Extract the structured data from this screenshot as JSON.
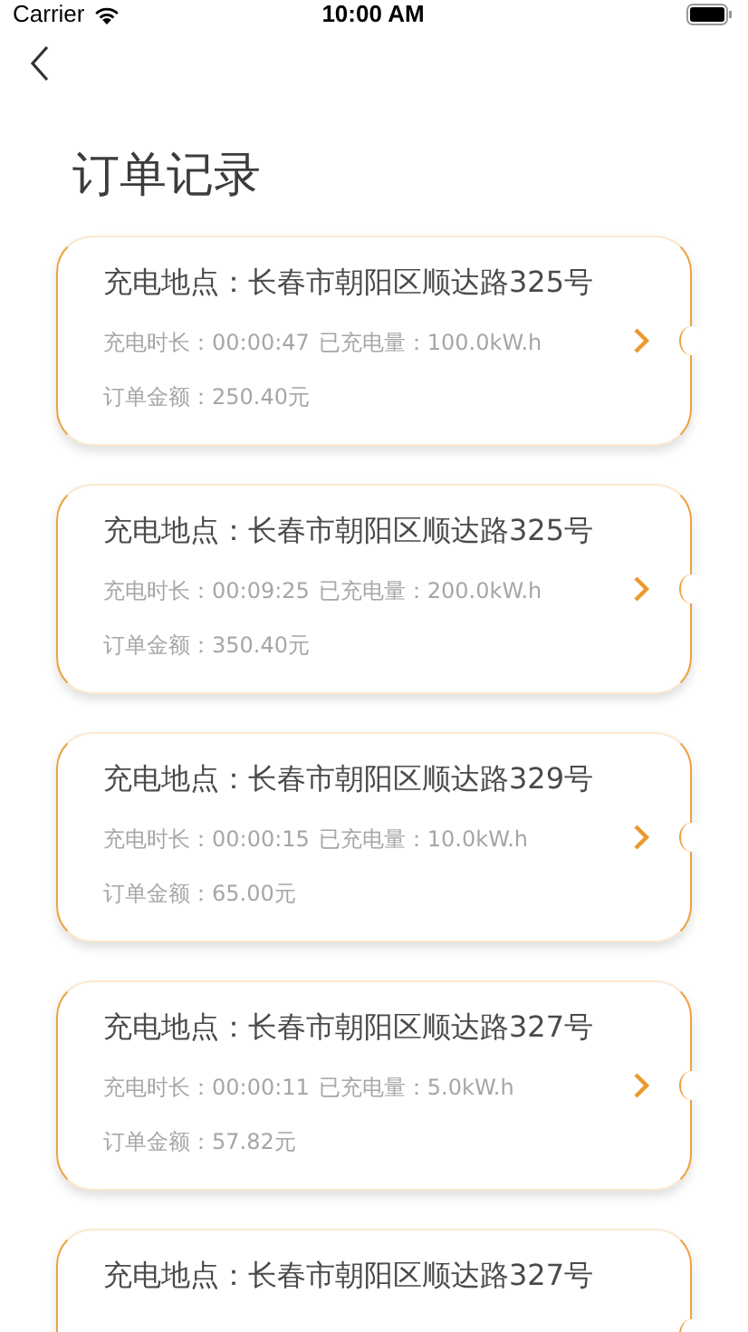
{
  "status_bar": {
    "carrier": "Carrier",
    "time": "10:00 AM"
  },
  "title": "订单记录",
  "orders": [
    {
      "location": "充电地点：长春市朝阳区顺达路325号",
      "duration": "充电时长：00:00:47",
      "energy": "已充电量：100.0kW.h",
      "amount": "订单金额：250.40元"
    },
    {
      "location": "充电地点：长春市朝阳区顺达路325号",
      "duration": "充电时长：00:09:25",
      "energy": "已充电量：200.0kW.h",
      "amount": "订单金额：350.40元"
    },
    {
      "location": "充电地点：长春市朝阳区顺达路329号",
      "duration": "充电时长：00:00:15",
      "energy": "已充电量：10.0kW.h",
      "amount": "订单金额：65.00元"
    },
    {
      "location": "充电地点：长春市朝阳区顺达路327号",
      "duration": "充电时长：00:00:11",
      "energy": "已充电量：5.0kW.h",
      "amount": "订单金额：57.82元"
    },
    {
      "location": "充电地点：长春市朝阳区顺达路327号"
    }
  ]
}
